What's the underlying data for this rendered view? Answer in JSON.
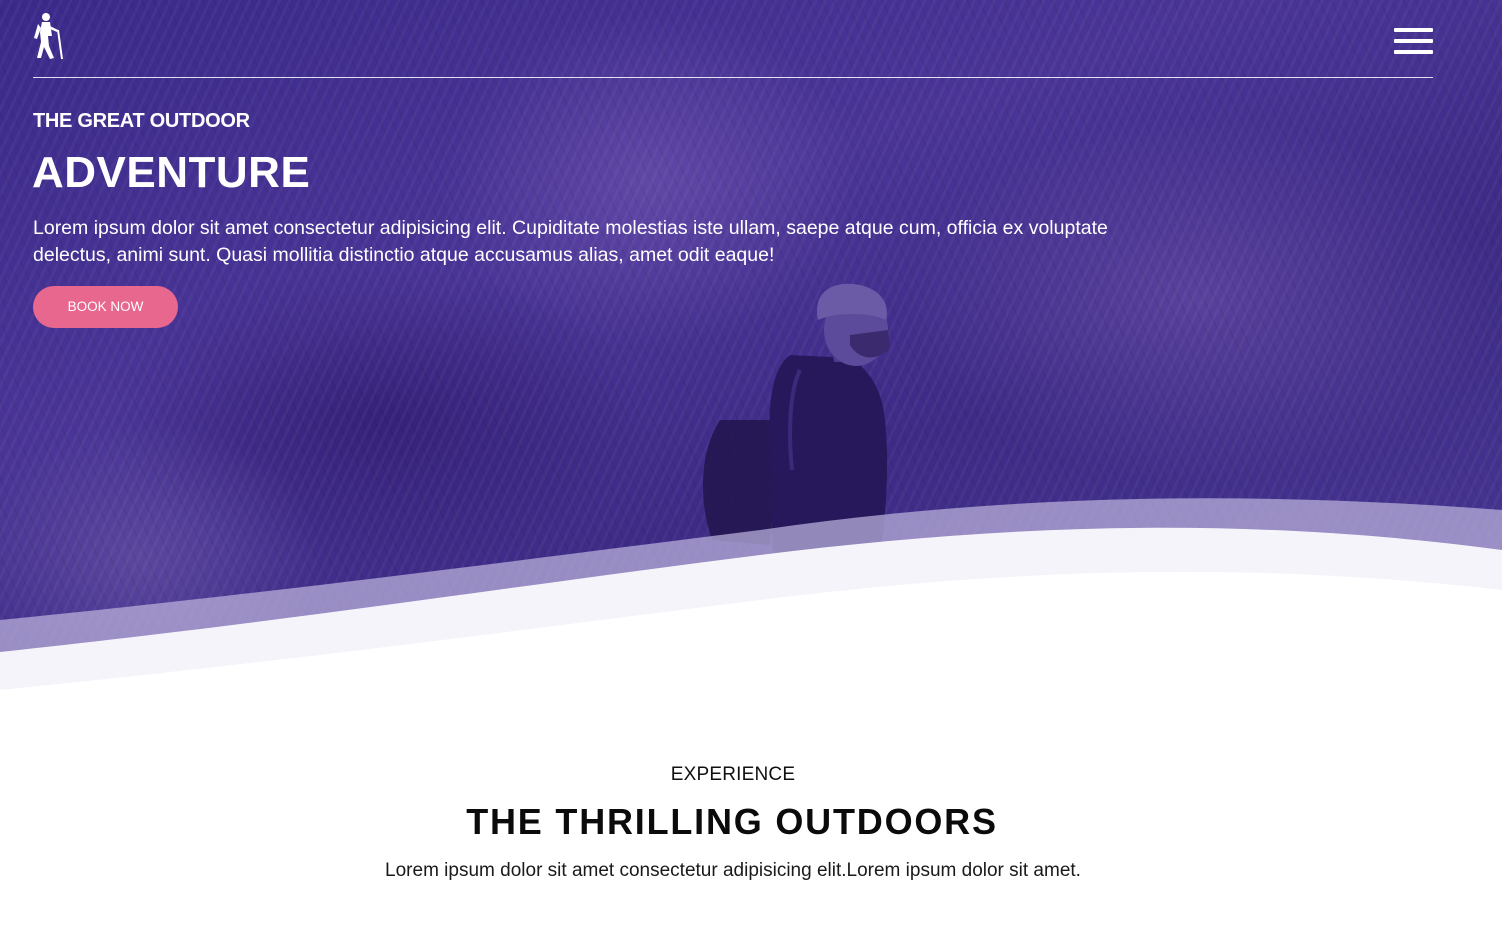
{
  "header": {
    "logo_icon": "hiker-logo-icon",
    "menu_icon": "hamburger-menu-icon"
  },
  "hero": {
    "eyebrow": "THE GREAT OUTDOOR",
    "headline": "ADVENTURE",
    "description": "Lorem ipsum dolor sit amet consectetur adipisicing elit. Cupiditate molestias iste ullam, saepe atque cum, officia ex voluptate delectus, animi sunt. Quasi mollitia distinctio atque accusamus alias, amet odit eaque!",
    "cta_label": "BOOK NOW",
    "image": "hiker-in-forest-photo",
    "overlay_color": "#3d2b8a",
    "cta_color": "#e8678f"
  },
  "experience": {
    "eyebrow": "EXPERIENCE",
    "title": "THE THRILLING OUTDOORS",
    "description": "Lorem ipsum dolor sit amet consectetur adipisicing elit.Lorem ipsum dolor sit amet."
  }
}
